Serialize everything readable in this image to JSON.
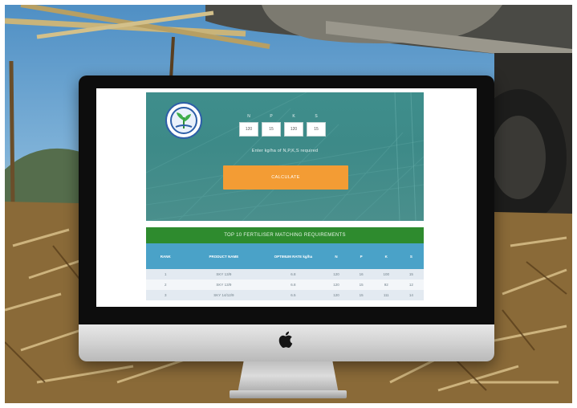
{
  "hero": {
    "npk_letters": [
      "N",
      "P",
      "K",
      "S"
    ],
    "npk_values": [
      "120",
      "15",
      "120",
      "15"
    ],
    "caption": "Enter kg/ha of N,P,K,S required",
    "calculate_label": "CALCULATE"
  },
  "results": {
    "title": "TOP 10 FERTILISER MATCHING REQUIREMENTS",
    "headers": [
      "RANK",
      "PRODUCT NAME",
      "OPTIMUM RATE kg/ha",
      "N",
      "P",
      "K",
      "S"
    ],
    "rows": [
      [
        "1",
        "SKY 13/9",
        "6.8",
        "120",
        "16",
        "100",
        "15"
      ],
      [
        "2",
        "SKY 13/9",
        "6.8",
        "120",
        "15",
        "92",
        "12"
      ],
      [
        "3",
        "SKY 14/12/9",
        "6.5",
        "120",
        "15",
        "111",
        "14"
      ]
    ]
  },
  "colors": {
    "hero_teal": "#3f8e8c",
    "calculate_orange": "#f39c34",
    "results_green": "#2e8b2e",
    "table_header_blue": "#4aa2c8"
  },
  "icons": [
    "apple-logo-icon",
    "brand-logo-icon"
  ]
}
